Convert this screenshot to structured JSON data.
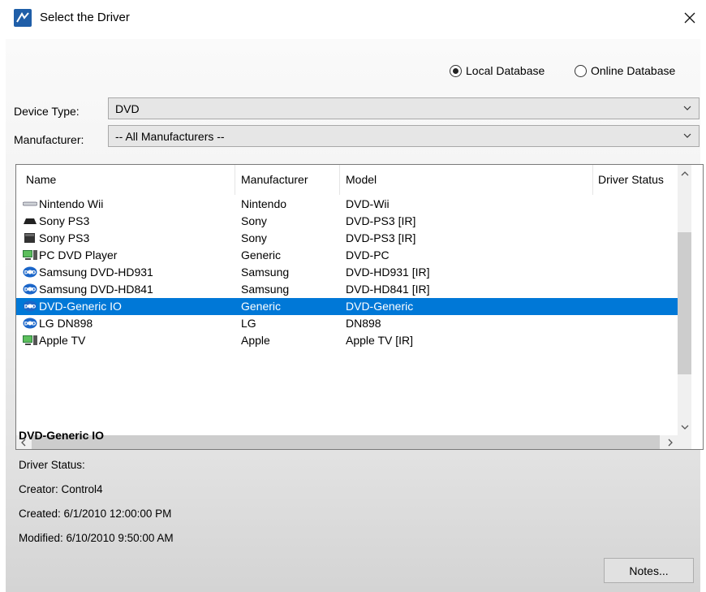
{
  "window": {
    "title": "Select the Driver",
    "close_icon": "close-icon",
    "app_icon": "control4-app-icon"
  },
  "source": {
    "local_label": "Local Database",
    "online_label": "Online Database",
    "selected": "local"
  },
  "filters": {
    "device_type_label": "Device Type:",
    "device_type_value": "DVD",
    "manufacturer_label": "Manufacturer:",
    "manufacturer_value": "-- All Manufacturers --"
  },
  "table": {
    "columns": [
      "Name",
      "Manufacturer",
      "Model",
      "Driver Status"
    ],
    "rows": [
      {
        "icon": "slim-console-icon",
        "name": "Nintendo Wii",
        "manufacturer": "Nintendo",
        "model": "DVD-Wii",
        "status": ""
      },
      {
        "icon": "console-icon",
        "name": "Sony PS3",
        "manufacturer": "Sony",
        "model": "DVD-PS3 [IR]",
        "status": ""
      },
      {
        "icon": "console-tower-icon",
        "name": "Sony PS3",
        "manufacturer": "Sony",
        "model": "DVD-PS3 [IR]",
        "status": ""
      },
      {
        "icon": "pc-icon",
        "name": "PC DVD Player",
        "manufacturer": "Generic",
        "model": "DVD-PC",
        "status": ""
      },
      {
        "icon": "dvd-disc-icon",
        "name": "Samsung DVD-HD931",
        "manufacturer": "Samsung",
        "model": "DVD-HD931 [IR]",
        "status": ""
      },
      {
        "icon": "dvd-disc-icon",
        "name": "Samsung DVD-HD841",
        "manufacturer": "Samsung",
        "model": "DVD-HD841 [IR]",
        "status": ""
      },
      {
        "icon": "dvd-disc-icon",
        "name": "DVD-Generic IO",
        "manufacturer": "Generic",
        "model": "DVD-Generic",
        "status": "",
        "selected": true
      },
      {
        "icon": "dvd-disc-icon",
        "name": "LG DN898",
        "manufacturer": "LG",
        "model": "DN898",
        "status": ""
      },
      {
        "icon": "pc-icon",
        "name": "Apple TV",
        "manufacturer": "Apple",
        "model": "Apple TV [IR]",
        "status": ""
      }
    ]
  },
  "details": {
    "name": "DVD-Generic IO",
    "driver_status": "Driver Status:",
    "creator": "Creator: Control4",
    "created": "Created: 6/1/2010 12:00:00 PM",
    "modified": "Modified: 6/10/2010 9:50:00 AM"
  },
  "buttons": {
    "notes": "Notes..."
  },
  "colors": {
    "selection": "#0078d7",
    "app_icon": "#1f5ea8"
  }
}
